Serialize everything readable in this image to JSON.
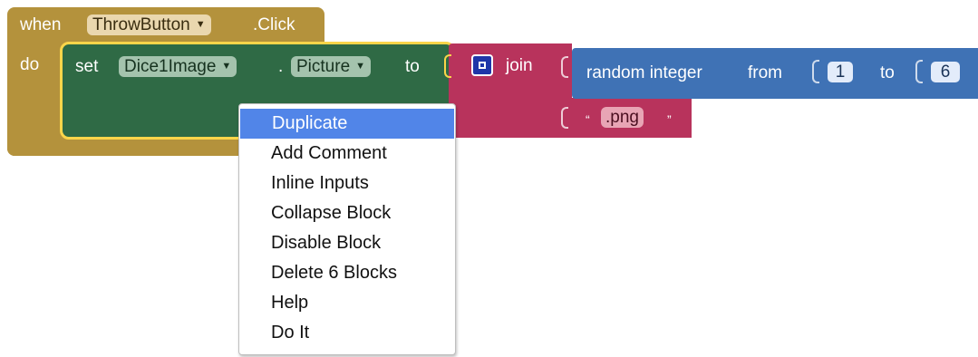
{
  "event_block": {
    "when_label": "when",
    "component": "ThrowButton",
    "event": ".Click",
    "do_label": "do"
  },
  "set_block": {
    "set_label": "set",
    "component": "Dice1Image",
    "dot": ".",
    "property": "Picture",
    "to_label": "to"
  },
  "join_block": {
    "label": "join",
    "text_open_quote": "“",
    "text_value": ".png",
    "text_close_quote": "”"
  },
  "random_block": {
    "label": "random integer",
    "from_label": "from",
    "from_value": "1",
    "to_label": "to",
    "to_value": "6"
  },
  "context_menu": {
    "items": [
      "Duplicate",
      "Add Comment",
      "Inline Inputs",
      "Collapse Block",
      "Disable Block",
      "Delete 6 Blocks",
      "Help",
      "Do It"
    ],
    "active_index": 0
  },
  "colors": {
    "event_block": "#b4923c",
    "set_block": "#2f6a45",
    "selection_outline": "#fbd54a",
    "join_block": "#b8335c",
    "random_block": "#3f72b5",
    "menu_highlight": "#5185e8"
  }
}
